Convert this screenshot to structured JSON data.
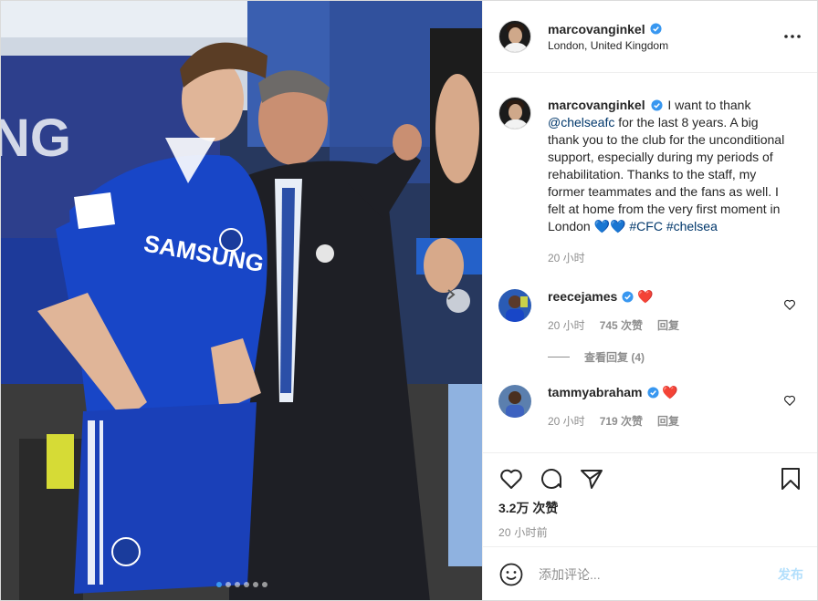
{
  "post": {
    "photo_alt": "Photo of a Chelsea player and coach at a match",
    "shirt_sponsor": "SAMSUNG",
    "stadium_text": "NG",
    "carousel_count": 6,
    "carousel_active": 0
  },
  "header": {
    "username": "marcovanginkel",
    "location": "London, United Kingdom",
    "more_icon": "more-horizontal-icon"
  },
  "caption": {
    "username": "marcovanginkel",
    "text_before_mention": "I want to thank",
    "mention": "@chelseafc",
    "text_after_mention": "for the last 8 years. A big thank you to the club for the unconditional support, especially during my periods of rehabilitation. Thanks to the staff, my former teammates and the fans as well. I felt at home from the very first moment in London",
    "emoji": "💙💙",
    "hashtags": "#CFC #chelsea",
    "time": "20 小时"
  },
  "comments": [
    {
      "username": "reecejames",
      "text": "❤️",
      "time": "20 小时",
      "likes": "745 次赞",
      "reply": "回复",
      "view_replies": "查看回复 (4)"
    },
    {
      "username": "tammyabraham",
      "text": "❤️",
      "time": "20 小时",
      "likes": "719 次赞",
      "reply": "回复"
    }
  ],
  "actions": {
    "like_icon": "heart-outline-icon",
    "comment_icon": "comment-bubble-icon",
    "share_icon": "paper-plane-icon",
    "save_icon": "bookmark-icon",
    "likes": "3.2万 次赞",
    "time": "20 小时前"
  },
  "add_comment": {
    "emoji_icon": "smiley-icon",
    "placeholder": "添加评论...",
    "post_label": "发布"
  },
  "colors": {
    "verified": "#3897f0",
    "mention": "#00376b",
    "post_disabled": "#b2dffc",
    "heart": "#ed4956",
    "chelsea_blue": "#1846c7"
  }
}
